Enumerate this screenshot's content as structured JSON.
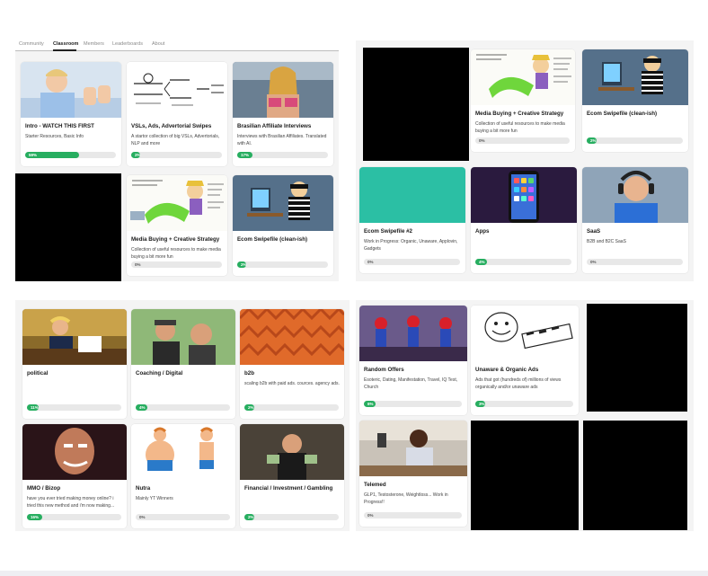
{
  "panel1": {
    "tabs": [
      "Community",
      "Classroom",
      "Members",
      "Leaderboards",
      "About"
    ],
    "cards": [
      {
        "title": "Intro - WATCH THIS FIRST",
        "desc": "Starter Resources, Basic Info",
        "progress_label": "59%",
        "progress": 59,
        "thumb": "man-thumbs-up"
      },
      {
        "title": "VSLs, Ads, Advertorial Swipes",
        "desc": "A startor collection of big VSLs, Advertorials, NLP and more",
        "progress_label": "2%",
        "progress": 2,
        "thumb": "whiteboard-sketch"
      },
      {
        "title": "Brasilian Affiliate Interviews",
        "desc": "Interviews with Brasilian Affiliates. Translated with AI.",
        "progress_label": "17%",
        "progress": 17,
        "thumb": "woman-photo"
      },
      {
        "title": "Media Buying + Creative Strategy",
        "desc": "Collection of useful resources to make media buying a bit more fun",
        "progress_label": "0%",
        "progress": 0,
        "thumb": "meme-comic"
      },
      {
        "title": "Ecom Swipefile (clean-ish)",
        "desc": "",
        "progress_label": "2%",
        "progress": 2,
        "thumb": "robber-computer"
      }
    ]
  },
  "panel2": {
    "cards": [
      {
        "title": "Media Buying + Creative Strategy",
        "desc": "Collection of useful resources to make media buying a bit more fun",
        "progress_label": "0%",
        "progress": 0,
        "thumb": "meme-comic"
      },
      {
        "title": "Ecom Swipefile (clean-ish)",
        "desc": "",
        "progress_label": "2%",
        "progress": 2,
        "thumb": "robber-computer"
      },
      {
        "title": "Ecom Swipefile #2",
        "desc": "Work in Progress: Organic, Unaware, Applovin, Gadgets",
        "progress_label": "0%",
        "progress": 0,
        "thumb": "teal-block"
      },
      {
        "title": "Apps",
        "desc": "",
        "progress_label": "4%",
        "progress": 4,
        "thumb": "phone-apps"
      },
      {
        "title": "SaaS",
        "desc": "B2B and B2C SaaS",
        "progress_label": "0%",
        "progress": 0,
        "thumb": "man-headset"
      }
    ]
  },
  "panel3": {
    "cards": [
      {
        "title": "political",
        "desc": "",
        "progress_label": "11%",
        "progress": 11,
        "thumb": "desk-photo"
      },
      {
        "title": "Coaching / Digital",
        "desc": "",
        "progress_label": "4%",
        "progress": 4,
        "thumb": "two-men"
      },
      {
        "title": "b2b",
        "desc": "scaling b2b with paid ads. cources. agency ads.",
        "progress_label": "2%",
        "progress": 2,
        "thumb": "orange-pattern"
      },
      {
        "title": "MMO / Bizop",
        "desc": "have you ever tried making money online? i tried this new method and i'm now making...",
        "progress_label": "16%",
        "progress": 16,
        "thumb": "man-dark"
      },
      {
        "title": "Nutra",
        "desc": "Mainly YT Winners",
        "progress_label": "0%",
        "progress": 0,
        "thumb": "fat-fit"
      },
      {
        "title": "Financial / Investment / Gambling",
        "desc": "",
        "progress_label": "2%",
        "progress": 2,
        "thumb": "money-man"
      }
    ]
  },
  "panel4": {
    "cards": [
      {
        "title": "Random Offers",
        "desc": "Esoteric, Dating, Manifestation, Travel, IQ Test, Church",
        "progress_label": "6%",
        "progress": 6,
        "thumb": "spiderman"
      },
      {
        "title": "Unaware & Organic Ads",
        "desc": "Ads that got (hundreds of) millions of views organically and/or unaware ads",
        "progress_label": "3%",
        "progress": 3,
        "thumb": "meme-sketch"
      },
      {
        "title": "Telemed",
        "desc": "GLP1, Testosterone, Weightloss... Work in Progress!!",
        "progress_label": "0%",
        "progress": 0,
        "thumb": "woman-kitchen"
      }
    ]
  },
  "colors": {
    "progress_fill": "#27ae60",
    "progress_track": "#e8e8e8",
    "panel_bg": "#f4f4f4"
  }
}
